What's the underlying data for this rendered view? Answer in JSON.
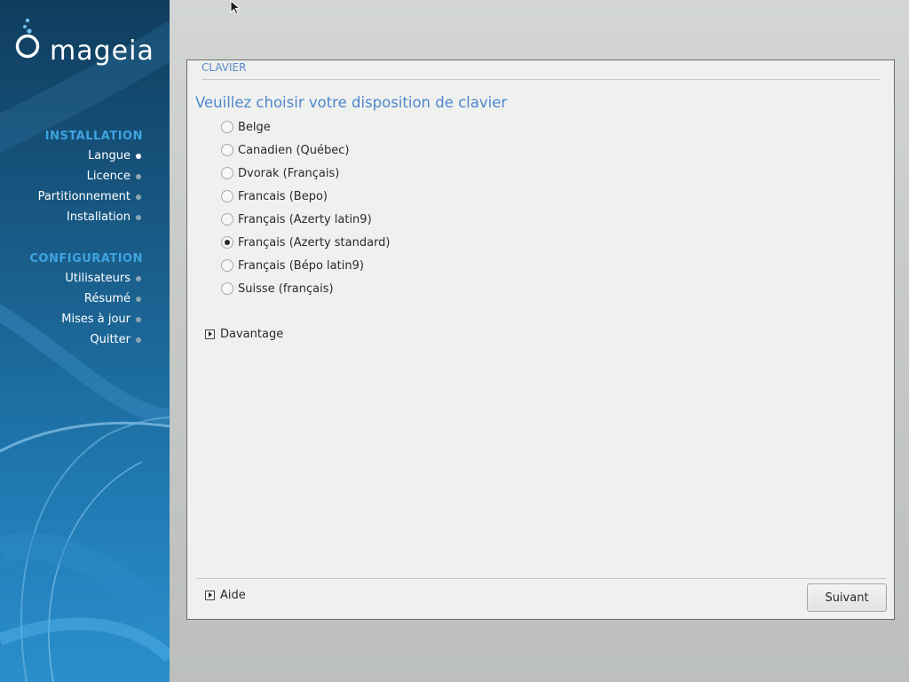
{
  "brand": {
    "name": "mageia"
  },
  "sidebar": {
    "sections": [
      {
        "title": "INSTALLATION",
        "steps": [
          "Langue",
          "Licence",
          "Partitionnement",
          "Installation"
        ]
      },
      {
        "title": "CONFIGURATION",
        "steps": [
          "Utilisateurs",
          "Résumé",
          "Mises à jour",
          "Quitter"
        ]
      }
    ],
    "active_step": "Langue"
  },
  "panel": {
    "header": "CLAVIER",
    "question": "Veuillez choisir votre disposition de clavier",
    "layouts": [
      {
        "label": "Belge",
        "selected": false
      },
      {
        "label": "Canadien (Québec)",
        "selected": false
      },
      {
        "label": "Dvorak (Français)",
        "selected": false
      },
      {
        "label": "Francais (Bepo)",
        "selected": false
      },
      {
        "label": "Français (Azerty latin9)",
        "selected": false
      },
      {
        "label": "Français (Azerty standard)",
        "selected": true
      },
      {
        "label": "Français (Bépo latin9)",
        "selected": false
      },
      {
        "label": "Suisse (français)",
        "selected": false
      }
    ],
    "more_label": "Davantage",
    "help_label": "Aide",
    "next_label": "Suivant"
  },
  "colors": {
    "accent": "#4f86cf",
    "sidebar_section": "#3fa3e0",
    "sidebar_bg": "#1a5f8c"
  }
}
